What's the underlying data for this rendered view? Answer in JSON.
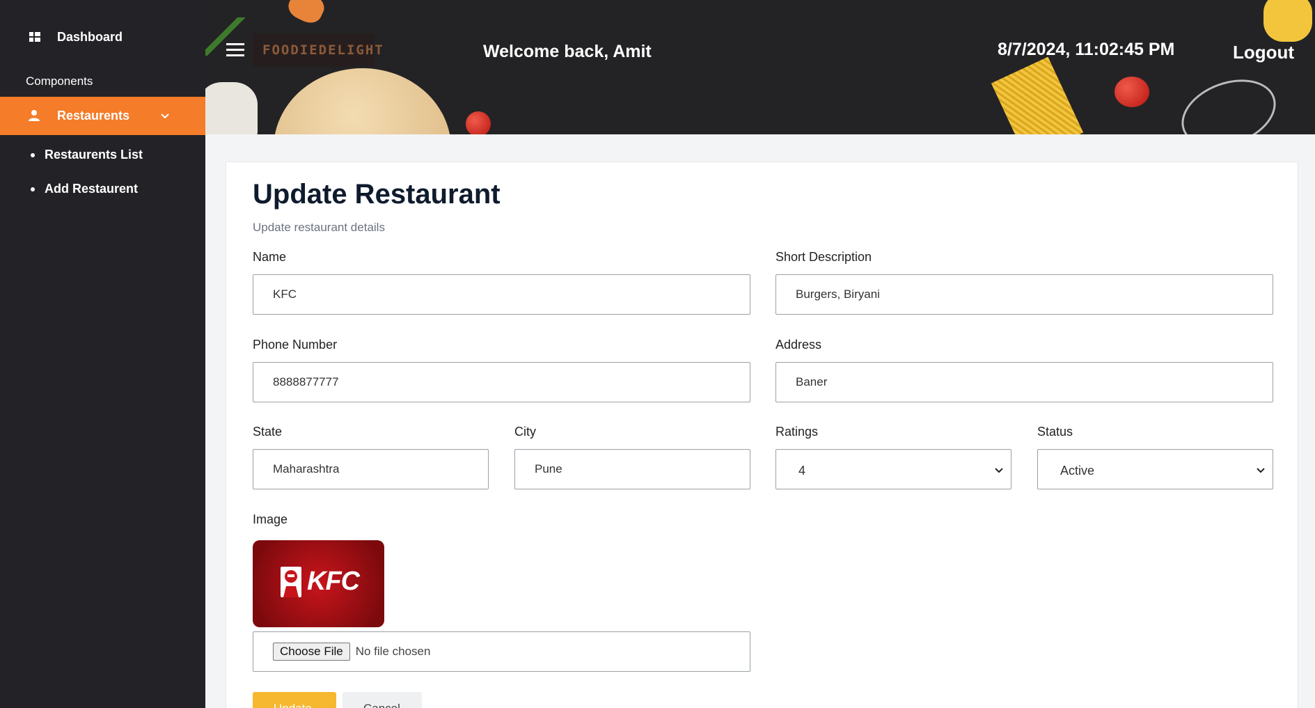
{
  "sidebar": {
    "dashboard_label": "Dashboard",
    "section_label": "Components",
    "restaurants_label": "Restaurents",
    "sub_items": [
      "Restaurents List",
      "Add Restaurent"
    ],
    "active_color": "#f57c29",
    "bg_color": "#232327"
  },
  "header": {
    "brand": "FOODIEDELIGHT",
    "welcome": "Welcome back, Amit",
    "datetime": "8/7/2024, 11:02:45 PM",
    "logout": "Logout"
  },
  "form": {
    "title": "Update Restaurant",
    "subtitle": "Update restaurant details",
    "name": {
      "label": "Name",
      "value": "KFC"
    },
    "short_description": {
      "label": "Short Description",
      "value": "Burgers, Biryani"
    },
    "phone": {
      "label": "Phone Number",
      "value": "8888877777"
    },
    "address": {
      "label": "Address",
      "value": "Baner"
    },
    "state": {
      "label": "State",
      "value": "Maharashtra"
    },
    "city": {
      "label": "City",
      "value": "Pune"
    },
    "ratings": {
      "label": "Ratings",
      "value": "4"
    },
    "status": {
      "label": "Status",
      "value": "Active"
    },
    "image": {
      "label": "Image",
      "logo_text": "KFC",
      "choose_label": "Choose File",
      "file_status": "No file chosen"
    },
    "update_label": "Update",
    "cancel_label": "Cancel",
    "accent_color": "#f5b82e"
  }
}
